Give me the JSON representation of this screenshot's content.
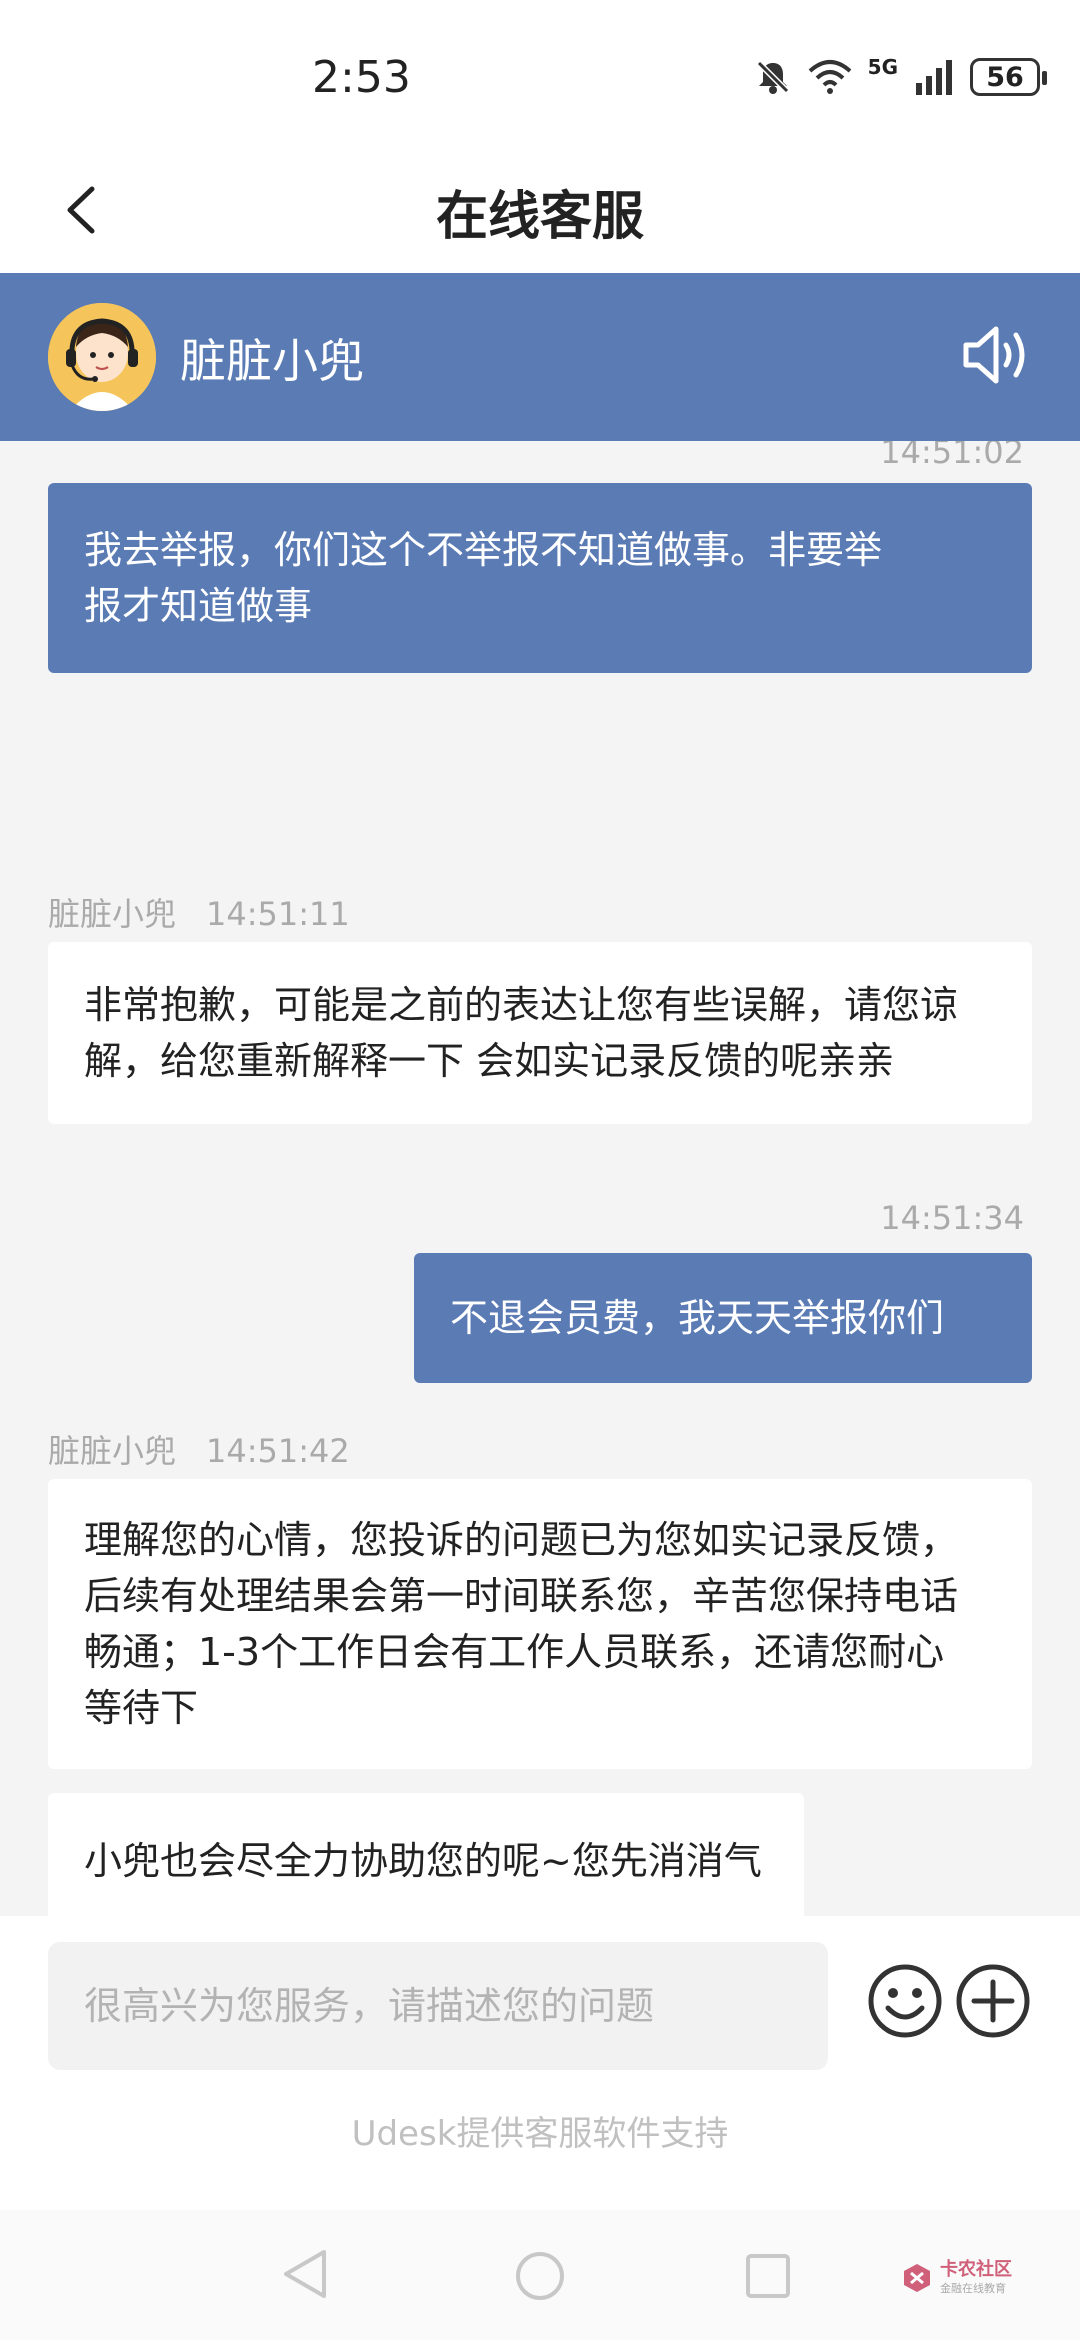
{
  "status_bar": {
    "time": "2:53",
    "network": "5G",
    "battery": "56"
  },
  "header": {
    "title": "在线客服"
  },
  "agent": {
    "name": "脏脏小兜"
  },
  "messages": [
    {
      "direction": "out",
      "timestamp": "14:51:02",
      "text_lines": [
        "我去举报，你们这个不举报不知道做事。非要举",
        "报才知道做事"
      ]
    },
    {
      "direction": "in",
      "sender": "脏脏小兜",
      "timestamp": "14:51:11",
      "text_lines": [
        "非常抱歉，可能是之前的表达让您有些误解，请您谅",
        "解，给您重新解释一下 会如实记录反馈的呢亲亲"
      ]
    },
    {
      "direction": "out",
      "timestamp": "14:51:34",
      "text_lines": [
        "不退会员费，我天天举报你们"
      ]
    },
    {
      "direction": "in",
      "sender": "脏脏小兜",
      "timestamp": "14:51:42",
      "text_lines": [
        "理解您的心情，您投诉的问题已为您如实记录反馈，",
        "后续有处理结果会第一时间联系您，辛苦您保持电话",
        "畅通；1-3个工作日会有工作人员联系，还请您耐心",
        "等待下"
      ]
    },
    {
      "direction": "in",
      "text_lines": [
        "小兜也会尽全力协助您的呢~您先消消气"
      ]
    }
  ],
  "input": {
    "placeholder": "很高兴为您服务，请描述您的问题",
    "value": ""
  },
  "footer": {
    "powered_by": "Udesk提供客服软件支持"
  },
  "watermark": {
    "title": "卡农社区",
    "subtitle": "金融在线教育"
  },
  "colors": {
    "accent": "#5b7bb5",
    "background": "#f4f4f4"
  }
}
